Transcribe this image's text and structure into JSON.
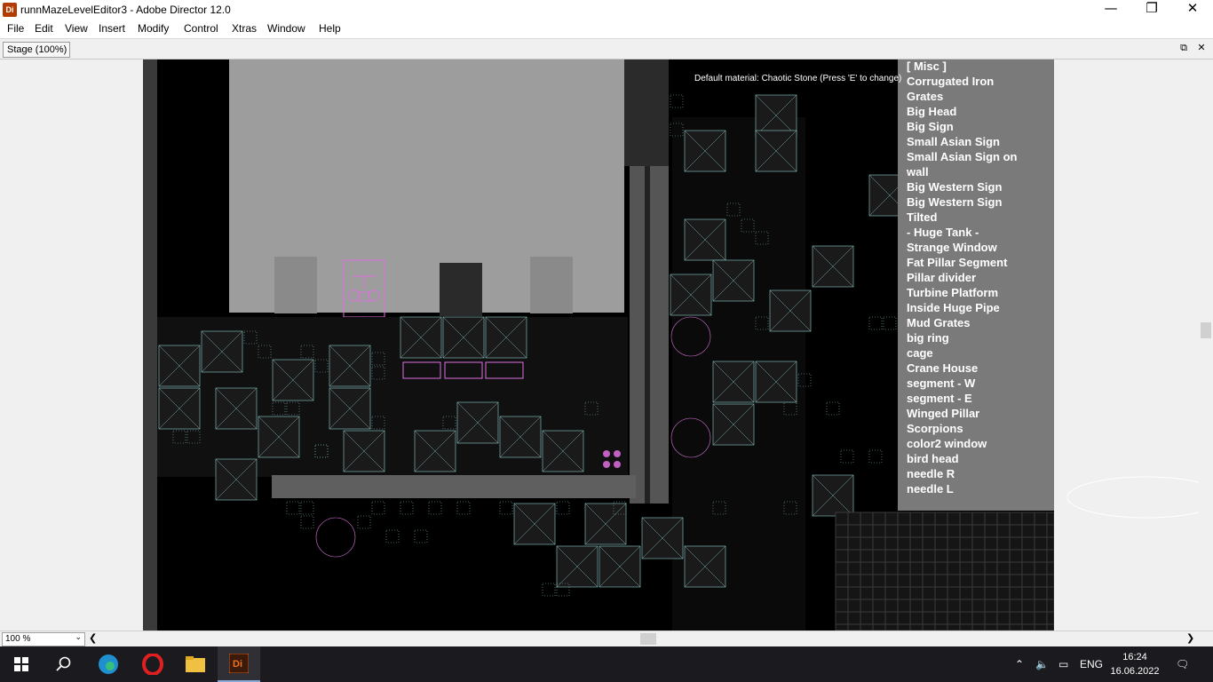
{
  "window": {
    "title": "runnMazeLevelEditor3 - Adobe Director 12.0",
    "app_icon_text": "Di"
  },
  "menu": [
    "File",
    "Edit",
    "View",
    "Insert",
    "Modify",
    "Control",
    "Xtras",
    "Window",
    "Help"
  ],
  "stage_tab": {
    "label": "Stage (100%)"
  },
  "editor": {
    "default_material": "Default material: Chaotic Stone (Press 'E' to change)",
    "props_list": [
      "[ Misc ]",
      "Corrugated Iron",
      "Grates",
      "Big Head",
      "Big Sign",
      "Small Asian Sign",
      "Small Asian Sign on",
      "wall",
      "Big Western Sign",
      "Big Western Sign",
      "Tilted",
      "- Huge Tank -",
      "Strange Window",
      "Fat Pillar Segment",
      "Pillar divider",
      "Turbine Platform",
      "Inside Huge Pipe",
      "Mud Grates",
      "big ring",
      "cage",
      "Crane House",
      "segment - W",
      "segment - E",
      "Winged Pillar",
      "Scorpions",
      "color2 window",
      "bird head",
      "needle R",
      "needle L"
    ]
  },
  "bottom": {
    "zoom": "100 %"
  },
  "taskbar": {
    "language": "ENG",
    "time": "16:24",
    "date": "16.06.2022",
    "apps": [
      "start-icon",
      "search-icon",
      "edge-icon",
      "opera-icon",
      "file-explorer-icon",
      "director-icon"
    ]
  },
  "colors": {
    "tile_outline": "#7fb3b3",
    "tile_highlight": "#e0ffff",
    "pink_prop": "#e070e0",
    "panel_gray": "#7a7a7a",
    "sky_gray": "#9a9a9a"
  }
}
